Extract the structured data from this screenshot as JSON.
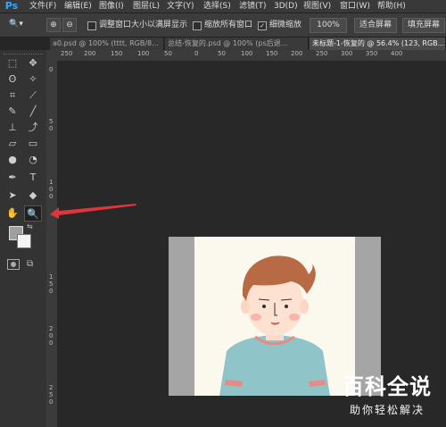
{
  "app": {
    "logo": "Ps"
  },
  "menu": [
    "文件(F)",
    "编辑(E)",
    "图像(I)",
    "图层(L)",
    "文字(Y)",
    "选择(S)",
    "滤镜(T)",
    "3D(D)",
    "视图(V)",
    "窗口(W)",
    "帮助(H)"
  ],
  "options": {
    "resize_windows_label": "调整窗口大小以满屏显示",
    "zoom_all_label": "缩放所有窗口",
    "scrubby_zoom_label": "细微缩放",
    "scrubby_zoom_checked": true,
    "zoom_100_label": "100%",
    "fit_screen_label": "适合屏幕",
    "fill_screen_label": "填充屏幕"
  },
  "tabs": [
    {
      "label": "a0.psd @ 100% (tttt, RGB/8...",
      "active": false
    },
    {
      "label": "总结-恢复的.psd @ 100% (ps后退...",
      "active": false
    },
    {
      "label": "未标题-1-恢复的 @ 56.4% (123, RGB...",
      "active": true
    }
  ],
  "ruler_top": [
    "250",
    "200",
    "150",
    "100",
    "50",
    "0",
    "50",
    "100",
    "150",
    "200",
    "250",
    "300",
    "350",
    "400"
  ],
  "ruler_left": [
    "0",
    "5",
    "0",
    "1",
    "0",
    "0",
    "1",
    "5",
    "0",
    "2",
    "0",
    "0",
    "2",
    "5",
    "0"
  ],
  "colors": {
    "accent": "#31a8ff",
    "arrow": "#e0363a",
    "hair": "#b86a44",
    "shirt": "#8fc4c8",
    "canvas_gray": "#a5a5a5"
  },
  "watermark": {
    "title": "百科全说",
    "subtitle": "助你轻松解决"
  }
}
